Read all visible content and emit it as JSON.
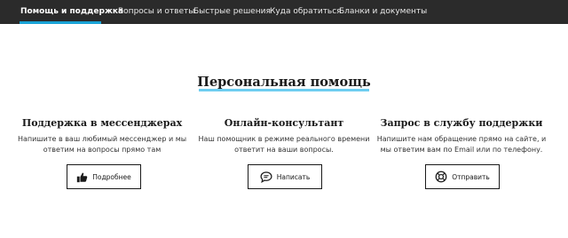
{
  "nav": {
    "items": [
      {
        "label": "Помощь и поддержка",
        "active": true
      },
      {
        "label": "Вопросы и ответы",
        "active": false
      },
      {
        "label": "Быстрые решения",
        "active": false
      },
      {
        "label": "Куда обратиться",
        "active": false
      },
      {
        "label": "Бланки и документы",
        "active": false
      }
    ]
  },
  "main": {
    "title": "Персональная помощь",
    "columns": [
      {
        "title": "Поддержка в мессенджерах",
        "text_line1": "Напишите в ваш любимый мессенджер и мы",
        "text_line2": "ответим на вопросы прямо там",
        "button_label": "Подробнее",
        "icon": "thumbs-up-icon"
      },
      {
        "title": "Онлайн-консультант",
        "text_line1": "Наш помощник в режиме реального времени",
        "text_line2": "ответит на ваши вопросы.",
        "button_label": "Написать",
        "icon": "chat-bubble-icon"
      },
      {
        "title": "Запрос в службу поддержки",
        "text_line1": "Напишите нам обращение прямо на сайте, и",
        "text_line2": "мы ответим вам по Email или по телефону.",
        "button_label": "Отправить",
        "icon": "lifebuoy-icon"
      }
    ]
  },
  "colors": {
    "nav_bg": "#2b2b2b",
    "accent": "#1aa3d6",
    "title_underline": "#5ec8ee"
  }
}
